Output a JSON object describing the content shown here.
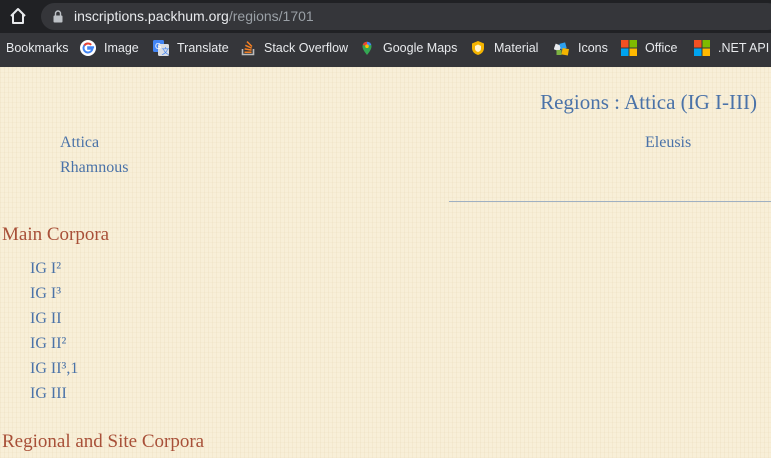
{
  "browser": {
    "url_host": "inscriptions.packhum.org",
    "url_path": "/regions/1701",
    "bookmarks": [
      {
        "label": "Bookmarks",
        "icon": "none"
      },
      {
        "label": "Image",
        "icon": "google-icon"
      },
      {
        "label": "Translate",
        "icon": "google-translate-icon"
      },
      {
        "label": "Stack Overflow",
        "icon": "stack-overflow-icon"
      },
      {
        "label": "Google Maps",
        "icon": "google-maps-icon"
      },
      {
        "label": "Material",
        "icon": "material-shield-icon"
      },
      {
        "label": "Icons",
        "icon": "icons-logo-icon"
      },
      {
        "label": "Office",
        "icon": "microsoft-icon"
      },
      {
        "label": ".NET API B",
        "icon": "microsoft-icon"
      }
    ]
  },
  "page": {
    "region_title": "Regions : Attica (IG I-III)",
    "subregions": [
      "Attica",
      "Rhamnous",
      "Eleusis"
    ],
    "main_corpora_title": "Main Corpora",
    "main_corpora": [
      "IG I²",
      "IG I³",
      "IG II",
      "IG II²",
      "IG II³,1",
      "IG III"
    ],
    "regional_corpora_title": "Regional and Site Corpora"
  }
}
